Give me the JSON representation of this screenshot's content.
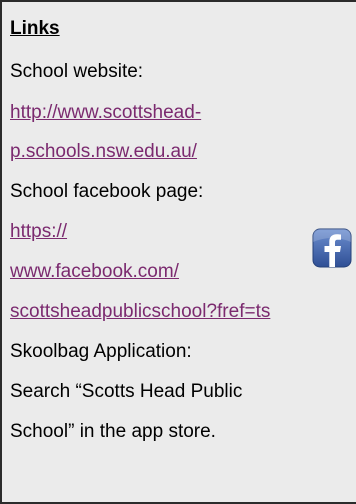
{
  "heading": "Links",
  "school_website_label": "School website:",
  "school_website_url": [
    "http://www.scottshead-",
    "p.schools.nsw.edu.au/"
  ],
  "facebook_label": "School facebook page:",
  "facebook_url": [
    "https://",
    "www.facebook.com/",
    "scottsheadpublicschool?fref=ts"
  ],
  "skoolbag_label": "Skoolbag Application:",
  "skoolbag_text": [
    "Search “Scotts Head Public",
    "School”  in the app store."
  ],
  "icons": {
    "facebook": "facebook-icon"
  },
  "colors": {
    "link": "#7b2a6f",
    "facebook_blue": "#3b5aa0"
  }
}
